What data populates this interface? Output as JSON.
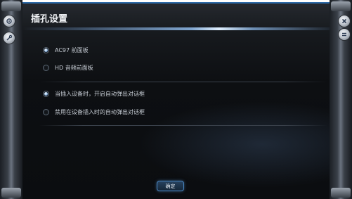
{
  "dialog": {
    "title": "插孔设置",
    "panel_options": [
      {
        "label": "AC97 前面板",
        "checked": true
      },
      {
        "label": "HD 音频前面板",
        "checked": false
      }
    ],
    "popup_options": [
      {
        "label": "当插入设备时，开启自动弹出对话框",
        "checked": true
      },
      {
        "label": "禁用在设备插入时的自动弹出对话框",
        "checked": false
      }
    ],
    "ok_label": "确定"
  },
  "side_buttons": {
    "left_top_icon": "gear-icon",
    "left_bottom_icon": "wrench-icon",
    "right_top_icon": "close-icon",
    "right_bottom_icon": "minimize-icon"
  },
  "colors": {
    "accent": "#4a88c4",
    "panel_bg": "#0d0f12",
    "text": "#c6ccd4"
  }
}
